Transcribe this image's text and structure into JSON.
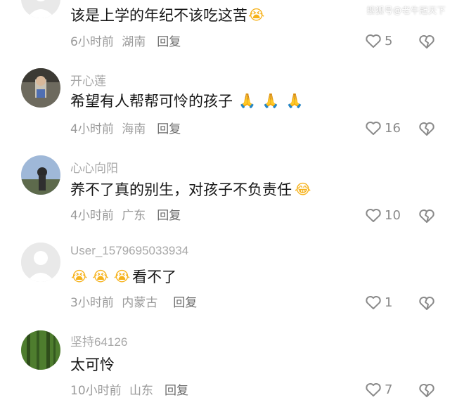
{
  "watermark": "搜狐号@老牛冠天下",
  "comments": [
    {
      "username": "",
      "text": "该是上学的年纪不该吃这苦",
      "emojis": [
        "😭"
      ],
      "time": "6小时前",
      "location": "湖南",
      "reply_label": "回复",
      "likes": "5"
    },
    {
      "username": "开心莲",
      "text": "希望有人帮帮可怜的孩子",
      "emojis": [
        "🙏",
        "🙏",
        "🙏"
      ],
      "time": "4小时前",
      "location": "海南",
      "reply_label": "回复",
      "likes": "16"
    },
    {
      "username": "心心向阳",
      "text": "养不了真的别生，对孩子不负责任",
      "emojis": [
        "😂"
      ],
      "time": "4小时前",
      "location": "广东",
      "reply_label": "回复",
      "likes": "10"
    },
    {
      "username": "User_1579695033934",
      "text": "看不了",
      "emojis_before": [
        "😭",
        "😭",
        "😭"
      ],
      "time": "3小时前",
      "location": "内蒙古",
      "reply_label": "回复",
      "likes": "1"
    },
    {
      "username": "坚持64126",
      "text": "太可怜",
      "emojis": [],
      "time": "10小时前",
      "location": "山东",
      "reply_label": "回复",
      "likes": "7"
    }
  ],
  "icons": {
    "like": "heart-outline-icon",
    "dislike": "broken-heart-icon"
  },
  "colors": {
    "username": "#a8a8a8",
    "text": "#161616",
    "meta": "#9a9a9a"
  }
}
